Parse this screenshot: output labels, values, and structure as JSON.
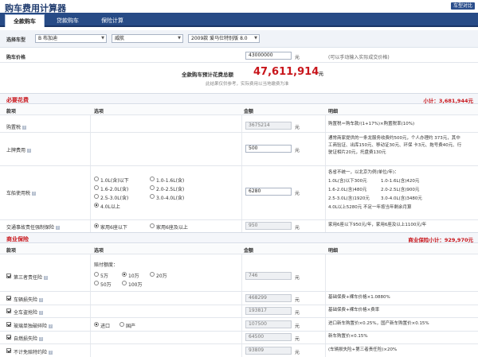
{
  "page": {
    "title": "购车费用计算器",
    "compare_label": "车型对比"
  },
  "tabs": [
    {
      "label": "全款购车"
    },
    {
      "label": "贷款购车"
    },
    {
      "label": "保险计算"
    }
  ],
  "filter": {
    "label": "选择车型",
    "brand": "B 布加迪",
    "series": "威航",
    "model": "2009款 爱马仕特别版 8.0"
  },
  "price": {
    "label": "购车价格",
    "value": "43000000",
    "unit": "元",
    "hint": "(可以手动输入实际成交价格)"
  },
  "total": {
    "label": "全款购车预计花费总额",
    "value": "47,611,914",
    "unit": "元",
    "note": "此结果仅供参考，实际费用以当地缴费为准"
  },
  "required": {
    "title": "必要花费",
    "subtotal": "小计：3,681,944元",
    "columns": [
      "款项",
      "选项",
      "金额",
      "明细"
    ],
    "purchase_tax": {
      "label": "购置税",
      "value": "3675214",
      "unit": "元",
      "detail": "购置税＝购车款/(1+17%)×购置税率(10%)"
    },
    "license_fee": {
      "label": "上牌费用",
      "value": "500",
      "unit": "元",
      "detail": [
        "通常商家提供的一条龙服务收费约500元，个人办理约 373元，其中",
        "工商验证、出库150元、移动证30元、环保 卡3元、拖号费40元、行",
        "驶证相片20元，托盘费130元"
      ]
    },
    "vehicle_tax": {
      "label": "车船使用税",
      "value": "6280",
      "unit": "元",
      "options": [
        "1.0L(含)以下",
        "1.0-1.6L(含)",
        "1.6-2.0L(含)",
        "2.0-2.5L(含)",
        "2.5-3.0L(含)",
        "3.0-4.0L(含)",
        "4.0L以上"
      ],
      "detail_title": "各省不统一，以北京为例(单位/年)：",
      "detail": [
        [
          "1.0L(含)以下300元",
          "1.0-1.6L(含)420元"
        ],
        [
          "1.6-2.0L(含)480元",
          "2.0-2.5L(含)900元"
        ],
        [
          "2.5-3.0L(含)1920元",
          "3.0-4.0L(含)3480元"
        ]
      ],
      "detail_last": "4.0L以上5280元   不足一年按当年剩余月算"
    },
    "compulsory": {
      "label": "交通事故责任强制保险",
      "value": "950",
      "unit": "元",
      "options": [
        "家用6座以下",
        "家用6座及以上"
      ],
      "detail": "家用6座以下950元/年，家用6座及以上1100元/年"
    }
  },
  "commercial": {
    "title": "商业保险",
    "subtotal": "商业保险小计：929,970元",
    "columns": [
      "款项",
      "选项",
      "金额",
      "明细"
    ],
    "third_party": {
      "label": "第三者责任险",
      "value": "746",
      "unit": "元",
      "limit_label": "赔付额度：",
      "limits": [
        "5万",
        "10万",
        "20万",
        "50万",
        "100万"
      ]
    },
    "vehicle_loss": {
      "label": "车辆损失险",
      "value": "468299",
      "unit": "元",
      "detail": "基础保费+裸车价格×1.0880%"
    },
    "theft": {
      "label": "全车盗抢险",
      "value": "193817",
      "unit": "元",
      "detail": "基础保费+裸车价格×费率"
    },
    "glass": {
      "label": "玻璃单独破碎险",
      "value": "107500",
      "unit": "元",
      "options": [
        "进口",
        "国产"
      ],
      "detail": "进口新车购置价×0.25%，国产新车购置价×0.15%"
    },
    "fire": {
      "label": "自燃损失险",
      "value": "64500",
      "unit": "元",
      "detail": "新车购置价×0.15%"
    },
    "deductible": {
      "label": "不计免赔特约险",
      "value": "93809",
      "unit": "元",
      "detail": "(车辆损失险+第三者责任险)×20%"
    }
  }
}
